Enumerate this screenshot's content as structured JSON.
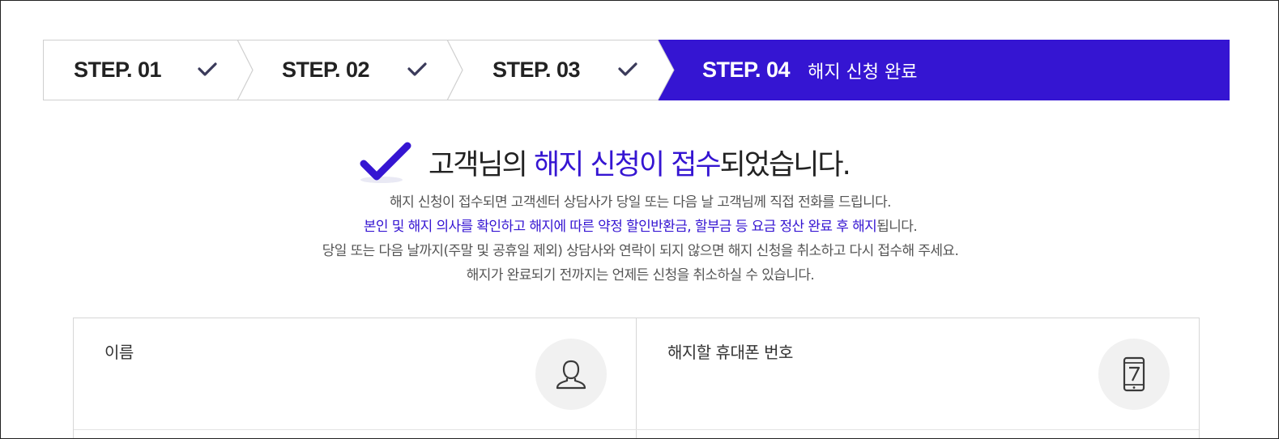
{
  "steps": [
    {
      "label": "STEP. 01",
      "status": "done"
    },
    {
      "label": "STEP. 02",
      "status": "done"
    },
    {
      "label": "STEP. 03",
      "status": "done"
    },
    {
      "label": "STEP. 04",
      "status": "active",
      "desc": "해지 신청 완료"
    }
  ],
  "headline": {
    "pre": "고객님의 ",
    "highlight": "해지 신청이 접수",
    "post": "되었습니다."
  },
  "desc": {
    "line1": "해지 신청이 접수되면 고객센터 상담사가 당일 또는 다음 날 고객님께 직접 전화를 드립니다.",
    "line2_accent": "본인 및 해지 의사를 확인하고 해지에 따른 약정 할인반환금, 할부금 등 요금 정산 완료 후 해지",
    "line2_rest": "됩니다.",
    "line3": "당일 또는 다음 날까지(주말 및 공휴일 제외) 상담사와 연락이 되지 않으면 해지 신청을 취소하고 다시 접수해 주세요.",
    "line4": "해지가 완료되기 전까지는 언제든 신청을 취소하실 수 있습니다."
  },
  "form": {
    "name_label": "이름",
    "phone_label": "해지할 휴대폰 번호",
    "name_icon": "user-icon",
    "phone_icon": "mobile-phone-icon"
  },
  "colors": {
    "accent": "#3515d2",
    "check": "#3a3a5a"
  }
}
